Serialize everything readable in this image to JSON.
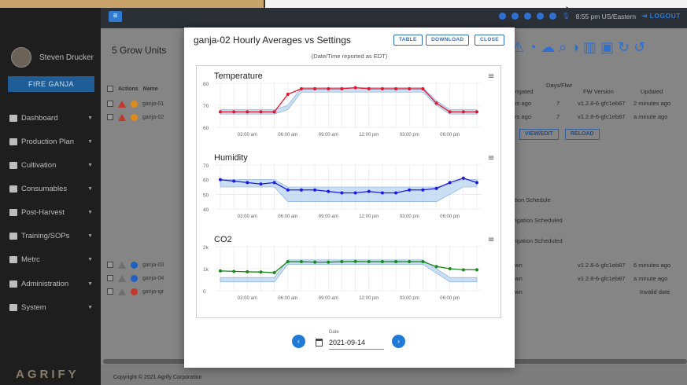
{
  "user": {
    "name": "Steven Drucker"
  },
  "sidebar": {
    "fire_button": "FIRE GANJA",
    "items": [
      {
        "label": "Dashboard"
      },
      {
        "label": "Production Plan"
      },
      {
        "label": "Cultivation"
      },
      {
        "label": "Consumables"
      },
      {
        "label": "Post-Harvest"
      },
      {
        "label": "Training/SOPs"
      },
      {
        "label": "Metrc"
      },
      {
        "label": "Administration"
      },
      {
        "label": "System"
      }
    ],
    "logo": "AGRIFY"
  },
  "topbar": {
    "time": "8:55 pm US/Eastern",
    "logout": "LOGOUT"
  },
  "main": {
    "title": "5 Grow Units",
    "table": {
      "columns": {
        "actions": "Actions",
        "name": "Name",
        "irrigated": "Irrigated",
        "days_flower": "Days/Flwr",
        "fw": "FW Version",
        "updated": "Updated"
      },
      "rows": [
        {
          "name": "ganja-01",
          "irrigated": "urs ago",
          "days": "7",
          "fw": "v1.2.8-6-gfc1eb87",
          "updated": "2 minutes ago"
        },
        {
          "name": "ganja-02",
          "irrigated": "urs ago",
          "days": "7",
          "fw": "v1.2.8-6-gfc1eb87",
          "updated": "a minute ago"
        },
        {
          "name": "ganja-03",
          "irrigated": "own",
          "days": "",
          "fw": "v1.2.8-6-gfc1eb87",
          "updated": "6 minutes ago"
        },
        {
          "name": "ganja-04",
          "irrigated": "own",
          "days": "",
          "fw": "v1.2.8-6-gfc1eb87",
          "updated": "a minute ago"
        },
        {
          "name": "ganja-igr",
          "irrigated": "own",
          "days": "",
          "fw": "",
          "updated": "Invalid date"
        }
      ]
    },
    "buttons": {
      "view_edit": "VIEW/EDIT",
      "reload": "RELOAD"
    },
    "schedule": {
      "header": "ation Schedule",
      "row1": "rrigation Scheduled",
      "row2": "rrigation Scheduled"
    },
    "footer": "Copyright © 2021 Agrify Corporation"
  },
  "modal": {
    "title": "ganja-02 Hourly Averages vs Settings",
    "subtitle": "(Date/Time reported as EDT)",
    "buttons": {
      "table": "TABLE",
      "download": "DOWNLOAD",
      "close": "CLOSE"
    },
    "date": {
      "label": "Date",
      "value": "2021-09-14"
    }
  },
  "chart_data": [
    {
      "type": "line",
      "title": "Temperature",
      "x": [
        "01:00",
        "02:00",
        "03:00",
        "04:00",
        "05:00",
        "06:00",
        "07:00",
        "08:00",
        "09:00",
        "10:00",
        "11:00",
        "12:00",
        "13:00",
        "14:00",
        "15:00",
        "16:00",
        "17:00",
        "18:00",
        "19:00",
        "20:00"
      ],
      "x_ticks": [
        "03:00 am",
        "06:00 am",
        "09:00 am",
        "12:00 pm",
        "03:00 pm",
        "06:00 pm"
      ],
      "ylim": [
        60,
        80
      ],
      "y_ticks": [
        60,
        70,
        80
      ],
      "series": [
        {
          "values": [
            67,
            67,
            67,
            67,
            67,
            75,
            77.5,
            77.5,
            77.5,
            77.5,
            78,
            77.5,
            77.5,
            77.5,
            77.5,
            77.5,
            71,
            67,
            67,
            67
          ]
        }
      ],
      "band": {
        "low": [
          66,
          66,
          66,
          66,
          66,
          68,
          76,
          76,
          76,
          76,
          76,
          76,
          76,
          76,
          76,
          76,
          70,
          66,
          66,
          66
        ],
        "high": [
          68,
          68,
          68,
          68,
          68,
          70,
          78,
          78,
          78,
          78,
          78,
          78,
          78,
          78,
          78,
          78,
          72,
          68,
          68,
          68
        ]
      },
      "color": "#e0152c"
    },
    {
      "type": "line",
      "title": "Humidity",
      "x": [
        "01:00",
        "02:00",
        "03:00",
        "04:00",
        "05:00",
        "06:00",
        "07:00",
        "08:00",
        "09:00",
        "10:00",
        "11:00",
        "12:00",
        "13:00",
        "14:00",
        "15:00",
        "16:00",
        "17:00",
        "18:00",
        "19:00",
        "20:00"
      ],
      "x_ticks": [
        "03:00 am",
        "06:00 am",
        "09:00 am",
        "12:00 pm",
        "03:00 pm",
        "06:00 pm"
      ],
      "ylim": [
        40,
        70
      ],
      "y_ticks": [
        40,
        50,
        60,
        70
      ],
      "series": [
        {
          "values": [
            60,
            59,
            58,
            57,
            58,
            53,
            53,
            53,
            52,
            51,
            51,
            52,
            51,
            51,
            53,
            53,
            54,
            58,
            61,
            58
          ]
        }
      ],
      "band": {
        "low": [
          55,
          55,
          55,
          55,
          55,
          45,
          45,
          45,
          45,
          45,
          45,
          45,
          45,
          45,
          45,
          45,
          45,
          50,
          55,
          55
        ],
        "high": [
          60,
          60,
          60,
          60,
          60,
          55,
          55,
          55,
          55,
          55,
          55,
          55,
          55,
          55,
          55,
          55,
          55,
          57,
          60,
          60
        ]
      },
      "color": "#1a1ae0"
    },
    {
      "type": "line",
      "title": "CO2",
      "x": [
        "01:00",
        "02:00",
        "03:00",
        "04:00",
        "05:00",
        "06:00",
        "07:00",
        "08:00",
        "09:00",
        "10:00",
        "11:00",
        "12:00",
        "13:00",
        "14:00",
        "15:00",
        "16:00",
        "17:00",
        "18:00",
        "19:00",
        "20:00"
      ],
      "x_ticks": [
        "03:00 am",
        "06:00 am",
        "09:00 am",
        "12:00 pm",
        "03:00 pm",
        "06:00 pm"
      ],
      "ylim": [
        0,
        2000
      ],
      "y_ticks": [
        "0",
        "1k",
        "2k"
      ],
      "series": [
        {
          "values": [
            900,
            880,
            860,
            850,
            820,
            1320,
            1320,
            1300,
            1300,
            1320,
            1330,
            1320,
            1320,
            1320,
            1320,
            1320,
            1100,
            1000,
            950,
            950
          ]
        }
      ],
      "band": {
        "low": [
          400,
          400,
          400,
          400,
          400,
          1200,
          1200,
          1200,
          1200,
          1200,
          1200,
          1200,
          1200,
          1200,
          1200,
          1200,
          800,
          400,
          400,
          400
        ],
        "high": [
          600,
          600,
          600,
          600,
          600,
          1400,
          1400,
          1400,
          1400,
          1400,
          1400,
          1400,
          1400,
          1400,
          1400,
          1400,
          1000,
          600,
          600,
          600
        ]
      },
      "color": "#1a8a1a"
    }
  ]
}
